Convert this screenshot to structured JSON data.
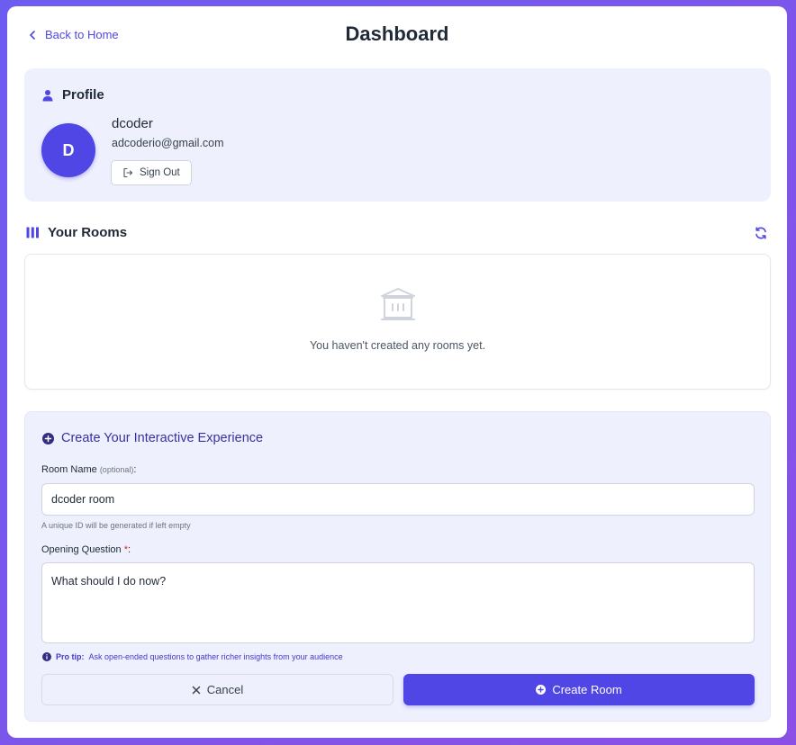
{
  "header": {
    "back_label": "Back to Home",
    "title": "Dashboard"
  },
  "profile": {
    "section_title": "Profile",
    "avatar_initial": "D",
    "username": "dcoder",
    "email": "adcoderio@gmail.com",
    "signout_label": "Sign Out"
  },
  "rooms": {
    "section_title": "Your Rooms",
    "empty_message": "You haven't created any rooms yet."
  },
  "create": {
    "title": "Create Your Interactive Experience",
    "room_name_label": "Room Name",
    "room_name_optional": "(optional)",
    "room_name_suffix": ":",
    "room_name_value": "dcoder room",
    "room_name_hint": "A unique ID will be generated if left empty",
    "question_label": "Opening Question",
    "question_required": "*",
    "question_suffix": ":",
    "question_value": "What should I do now?",
    "tip_prefix": "Pro tip:",
    "tip_text": "Ask open-ended questions to gather richer insights from your audience",
    "cancel_label": "Cancel",
    "create_label": "Create Room"
  },
  "colors": {
    "accent": "#4f46e5",
    "panel_bg": "#eef1fd",
    "page_gradient_start": "#6d5cf0",
    "page_gradient_end": "#8b4fe6"
  },
  "icons": [
    "chevron-left-icon",
    "user-icon",
    "logout-icon",
    "columns-icon",
    "refresh-icon",
    "building-icon",
    "plus-circle-icon",
    "info-icon",
    "close-icon"
  ]
}
